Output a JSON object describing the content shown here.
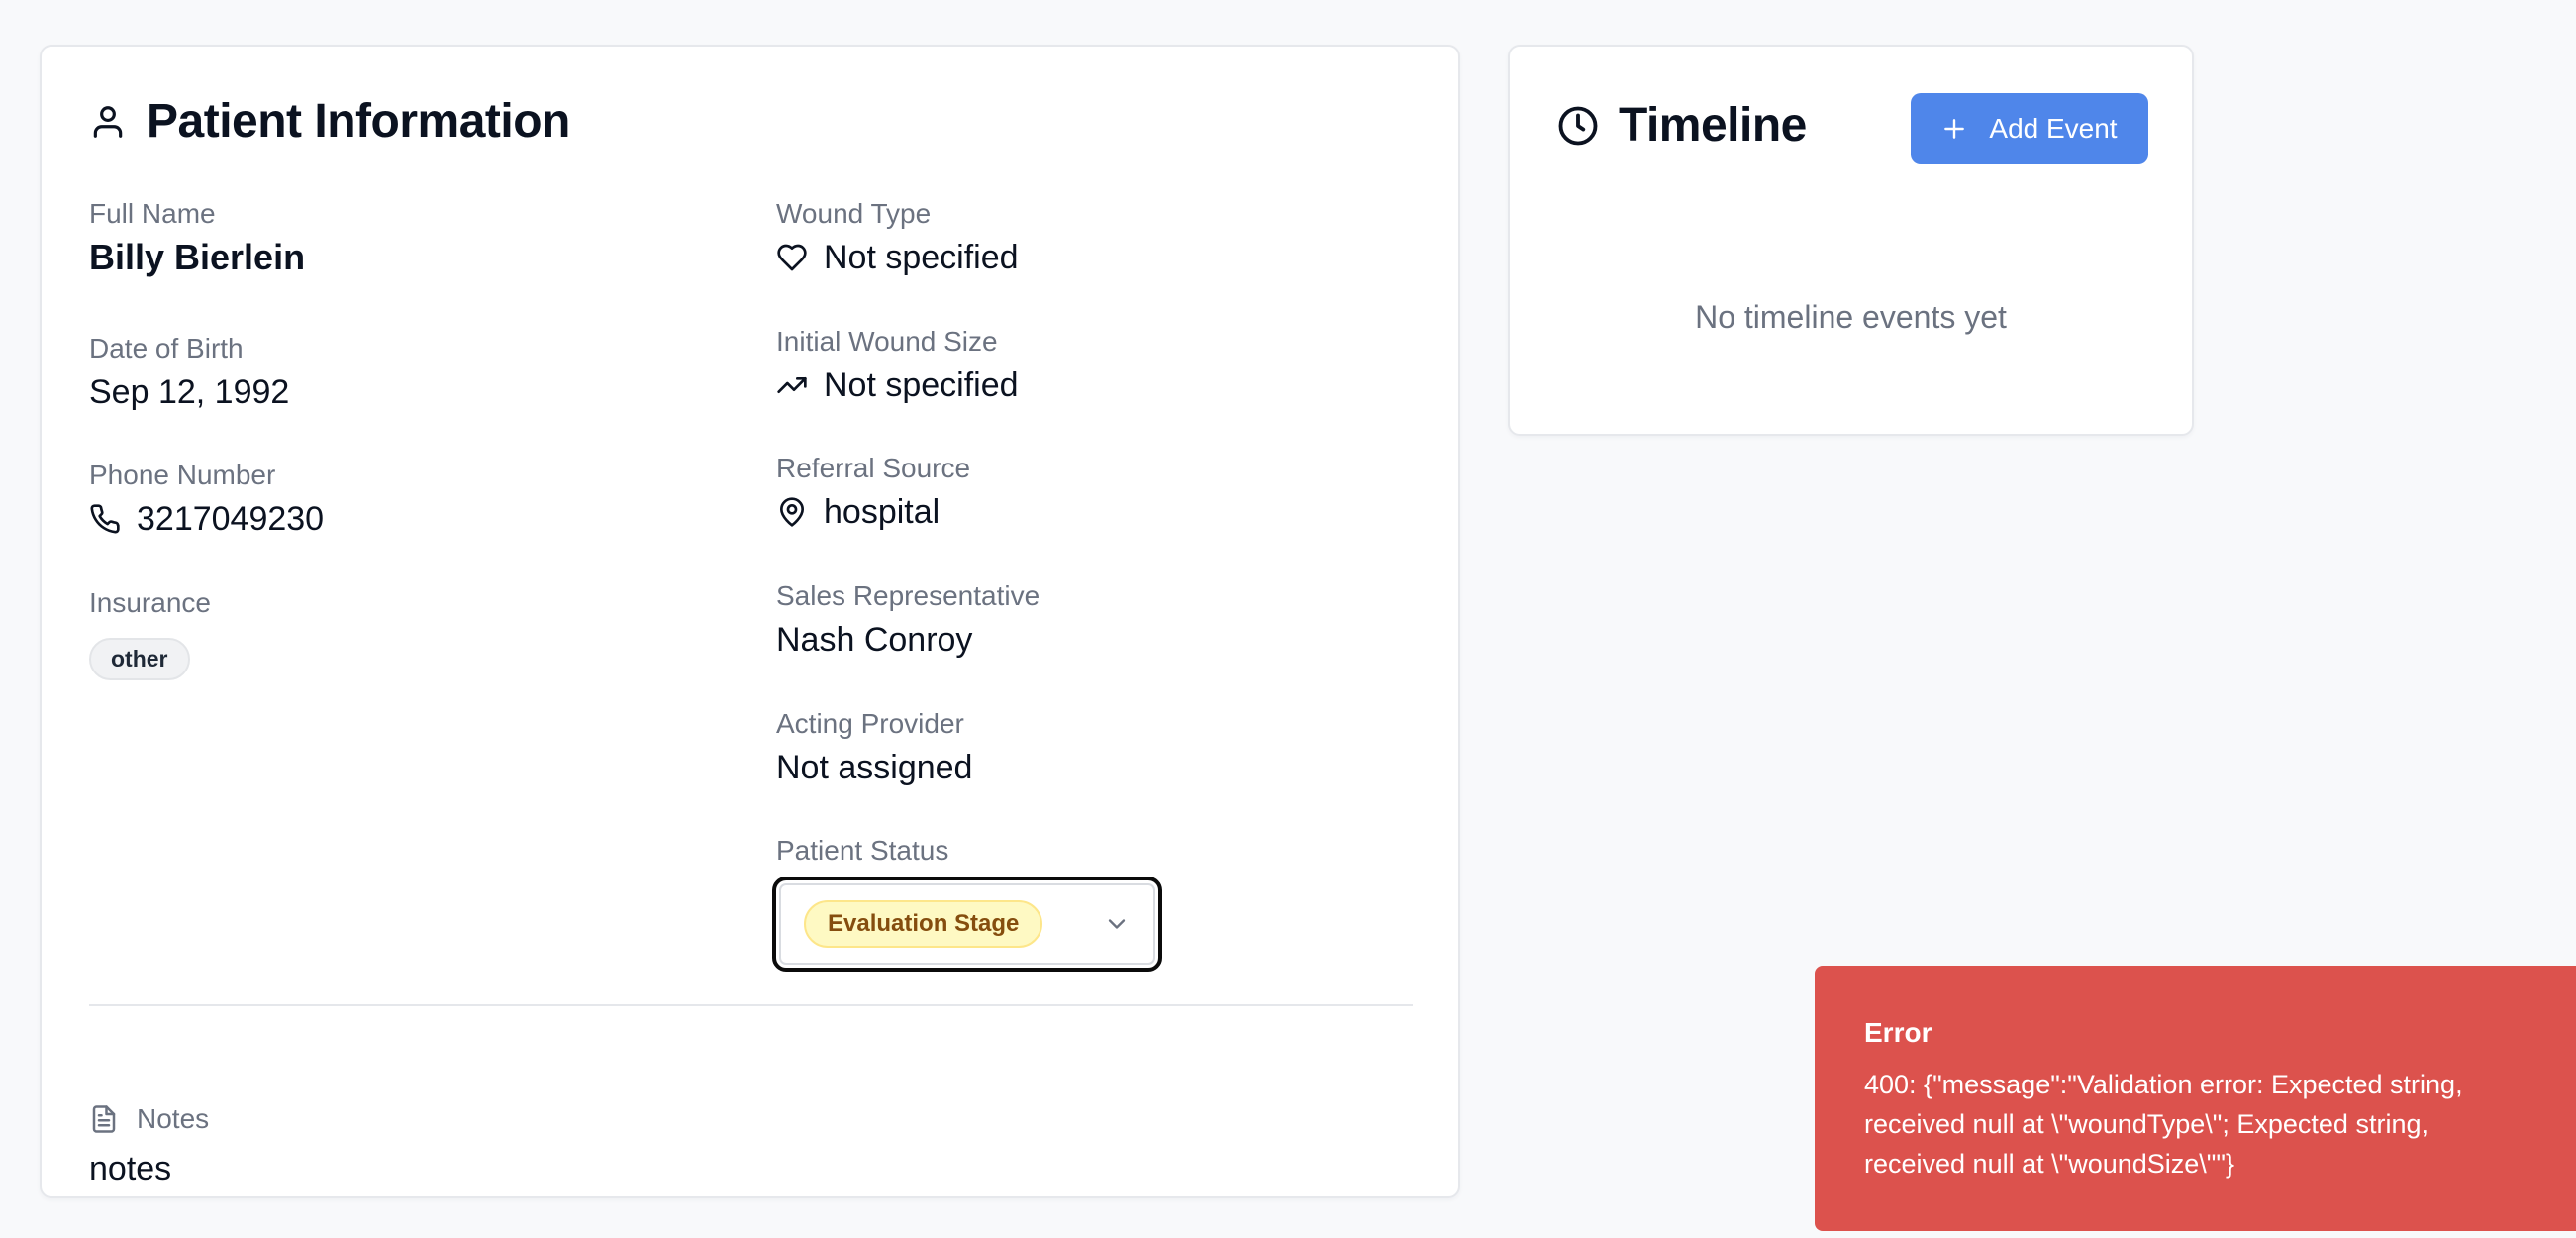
{
  "patient": {
    "title": "Patient Information",
    "fields": {
      "full_name": {
        "label": "Full Name",
        "value": "Billy Bierlein"
      },
      "dob": {
        "label": "Date of Birth",
        "value": "Sep 12, 1992"
      },
      "phone": {
        "label": "Phone Number",
        "value": "3217049230"
      },
      "insurance": {
        "label": "Insurance",
        "value": "other"
      },
      "wound_type": {
        "label": "Wound Type",
        "value": "Not specified"
      },
      "wound_size": {
        "label": "Initial Wound Size",
        "value": "Not specified"
      },
      "referral": {
        "label": "Referral Source",
        "value": "hospital"
      },
      "sales_rep": {
        "label": "Sales Representative",
        "value": "Nash Conroy"
      },
      "provider": {
        "label": "Acting Provider",
        "value": "Not assigned"
      },
      "status": {
        "label": "Patient Status",
        "value": "Evaluation Stage"
      }
    },
    "notes": {
      "label": "Notes",
      "value": "notes"
    }
  },
  "timeline": {
    "title": "Timeline",
    "add_button": "Add Event",
    "empty": "No timeline events yet"
  },
  "toast": {
    "title": "Error",
    "message": "400: {\"message\":\"Validation error: Expected string, received null at \\\"woundType\\\"; Expected string, received null at \\\"woundSize\\\"\"}"
  },
  "colors": {
    "accent": "#4f86ea",
    "error": "#dc524d",
    "status_badge_bg": "#fef9c3",
    "status_badge_text": "#854d0e"
  },
  "icons": [
    "user-icon",
    "heart-icon",
    "trending-up-icon",
    "phone-icon",
    "map-pin-icon",
    "file-text-icon",
    "clock-icon",
    "plus-icon",
    "chevron-down-icon"
  ]
}
